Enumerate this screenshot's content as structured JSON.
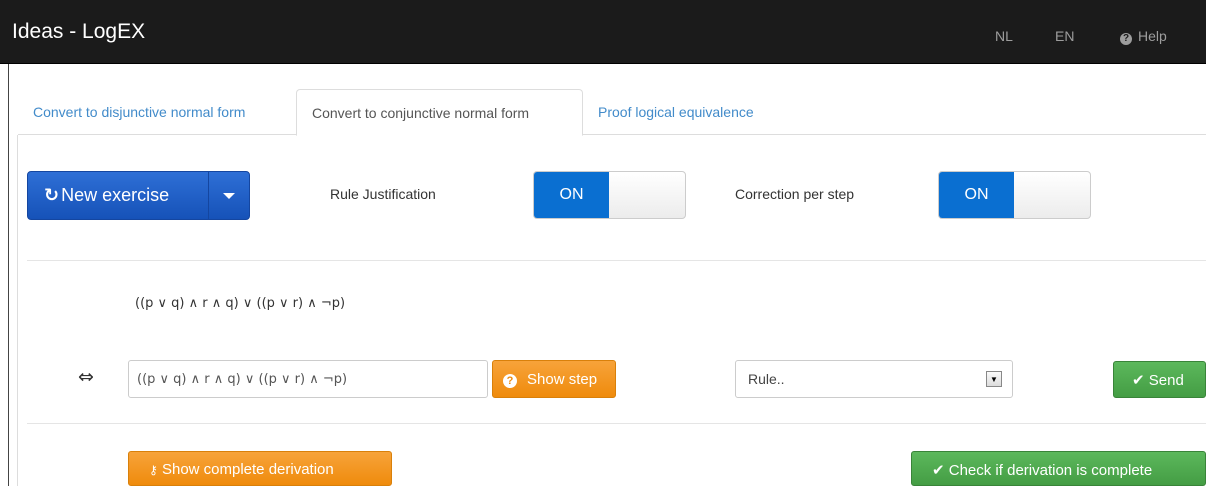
{
  "navbar": {
    "title": "Ideas - LogEX",
    "links": [
      {
        "label": "NL"
      },
      {
        "label": "EN"
      },
      {
        "label": "Help",
        "icon": "help-icon"
      }
    ]
  },
  "tabs": [
    {
      "label": "Convert to disjunctive normal form",
      "active": false
    },
    {
      "label": "Convert to conjunctive normal form",
      "active": true
    },
    {
      "label": "Proof logical equivalence",
      "active": false
    }
  ],
  "toolbar": {
    "new_exercise_label": "New exercise",
    "new_exercise_icon": "refresh-icon",
    "rule_justification_label": "Rule Justification",
    "rule_justification_state": "ON",
    "correction_label": "Correction per step",
    "correction_state": "ON"
  },
  "exercise": {
    "formula": "((p ∨ q) ∧ r ∧ q) ∨ ((p ∨ r) ∧ ¬p)",
    "equiv_symbol": "⇔",
    "input_value": "((p ∨ q) ∧ r ∧ q) ∨ ((p ∨ r) ∧ ¬p)",
    "show_step_label": "Show step",
    "rule_placeholder": "Rule..",
    "send_label": "Send"
  },
  "footer_actions": {
    "show_derivation_label": "Show complete derivation",
    "check_complete_label": "Check if derivation is complete"
  },
  "colors": {
    "navbar_bg": "#1b1b1b",
    "primary": "#0a6fd1",
    "warning": "#ef8b0c",
    "success": "#5cb85c",
    "link": "#428bca"
  }
}
